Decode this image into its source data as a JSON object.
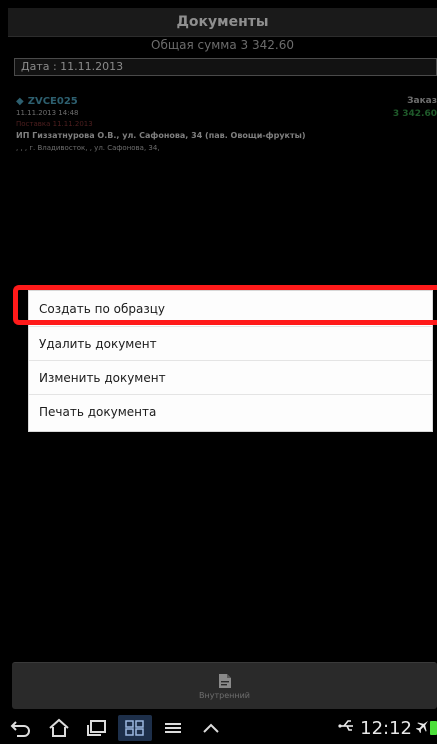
{
  "app": {
    "title": "Документы",
    "total": "Общая сумма 3 342.60",
    "date_field": "Дата : 11.11.2013"
  },
  "document": {
    "code": "ZVCE025",
    "datetime": "11.11.2013 14:48",
    "delivery": "Поставка 11.11.2013",
    "client": "ИП Гиззатнурова О.В., ул. Сафонова, 34 (пав. Овощи-фрукты)",
    "address": ", , , г. Владивосток, , ул. Сафонова, 34,",
    "kind": "Заказ",
    "amount": "3 342.60"
  },
  "menu": {
    "items": [
      {
        "label": "Создать по образцу"
      },
      {
        "label": "Удалить документ"
      },
      {
        "label": "Изменить документ"
      },
      {
        "label": "Печать документа"
      }
    ]
  },
  "bottom_bar": {
    "button_label": "Внутренний"
  },
  "status": {
    "time": "12:12"
  },
  "colors": {
    "highlight": "#ff1a1a",
    "battery": "#4cdf3a"
  }
}
